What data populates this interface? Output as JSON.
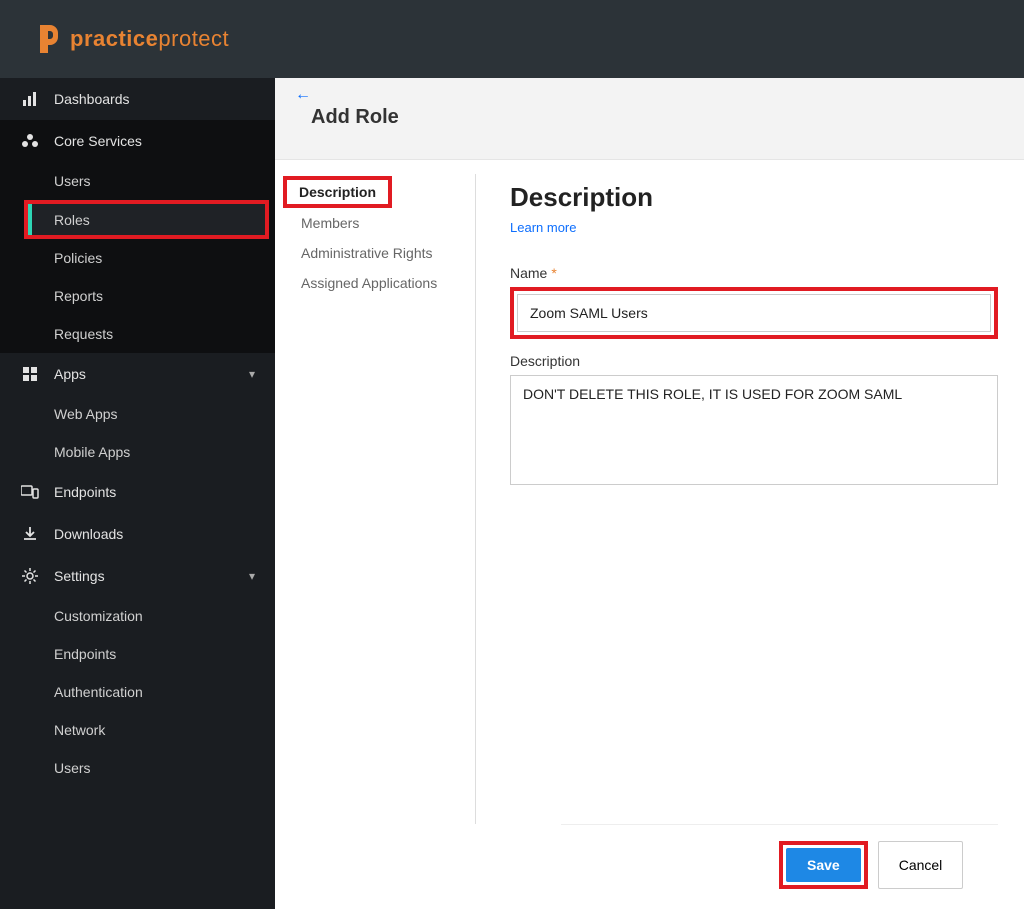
{
  "logo": {
    "brand_a": "practice",
    "brand_b": "protect"
  },
  "sidebar": {
    "dashboards": "Dashboards",
    "core_services": "Core Services",
    "core_items": [
      "Users",
      "Roles",
      "Policies",
      "Reports",
      "Requests"
    ],
    "apps": "Apps",
    "apps_items": [
      "Web Apps",
      "Mobile Apps"
    ],
    "endpoints": "Endpoints",
    "downloads": "Downloads",
    "settings": "Settings",
    "settings_items": [
      "Customization",
      "Endpoints",
      "Authentication",
      "Network",
      "Users"
    ]
  },
  "header": {
    "title": "Add Role"
  },
  "tabs": {
    "description": "Description",
    "members": "Members",
    "admin_rights": "Administrative Rights",
    "assigned_apps": "Assigned Applications"
  },
  "form": {
    "heading": "Description",
    "learn_more": "Learn more",
    "name_label": "Name",
    "name_value": "Zoom SAML Users",
    "desc_label": "Description",
    "desc_value": "DON'T DELETE THIS ROLE, IT IS USED FOR ZOOM SAML"
  },
  "footer": {
    "save": "Save",
    "cancel": "Cancel"
  }
}
